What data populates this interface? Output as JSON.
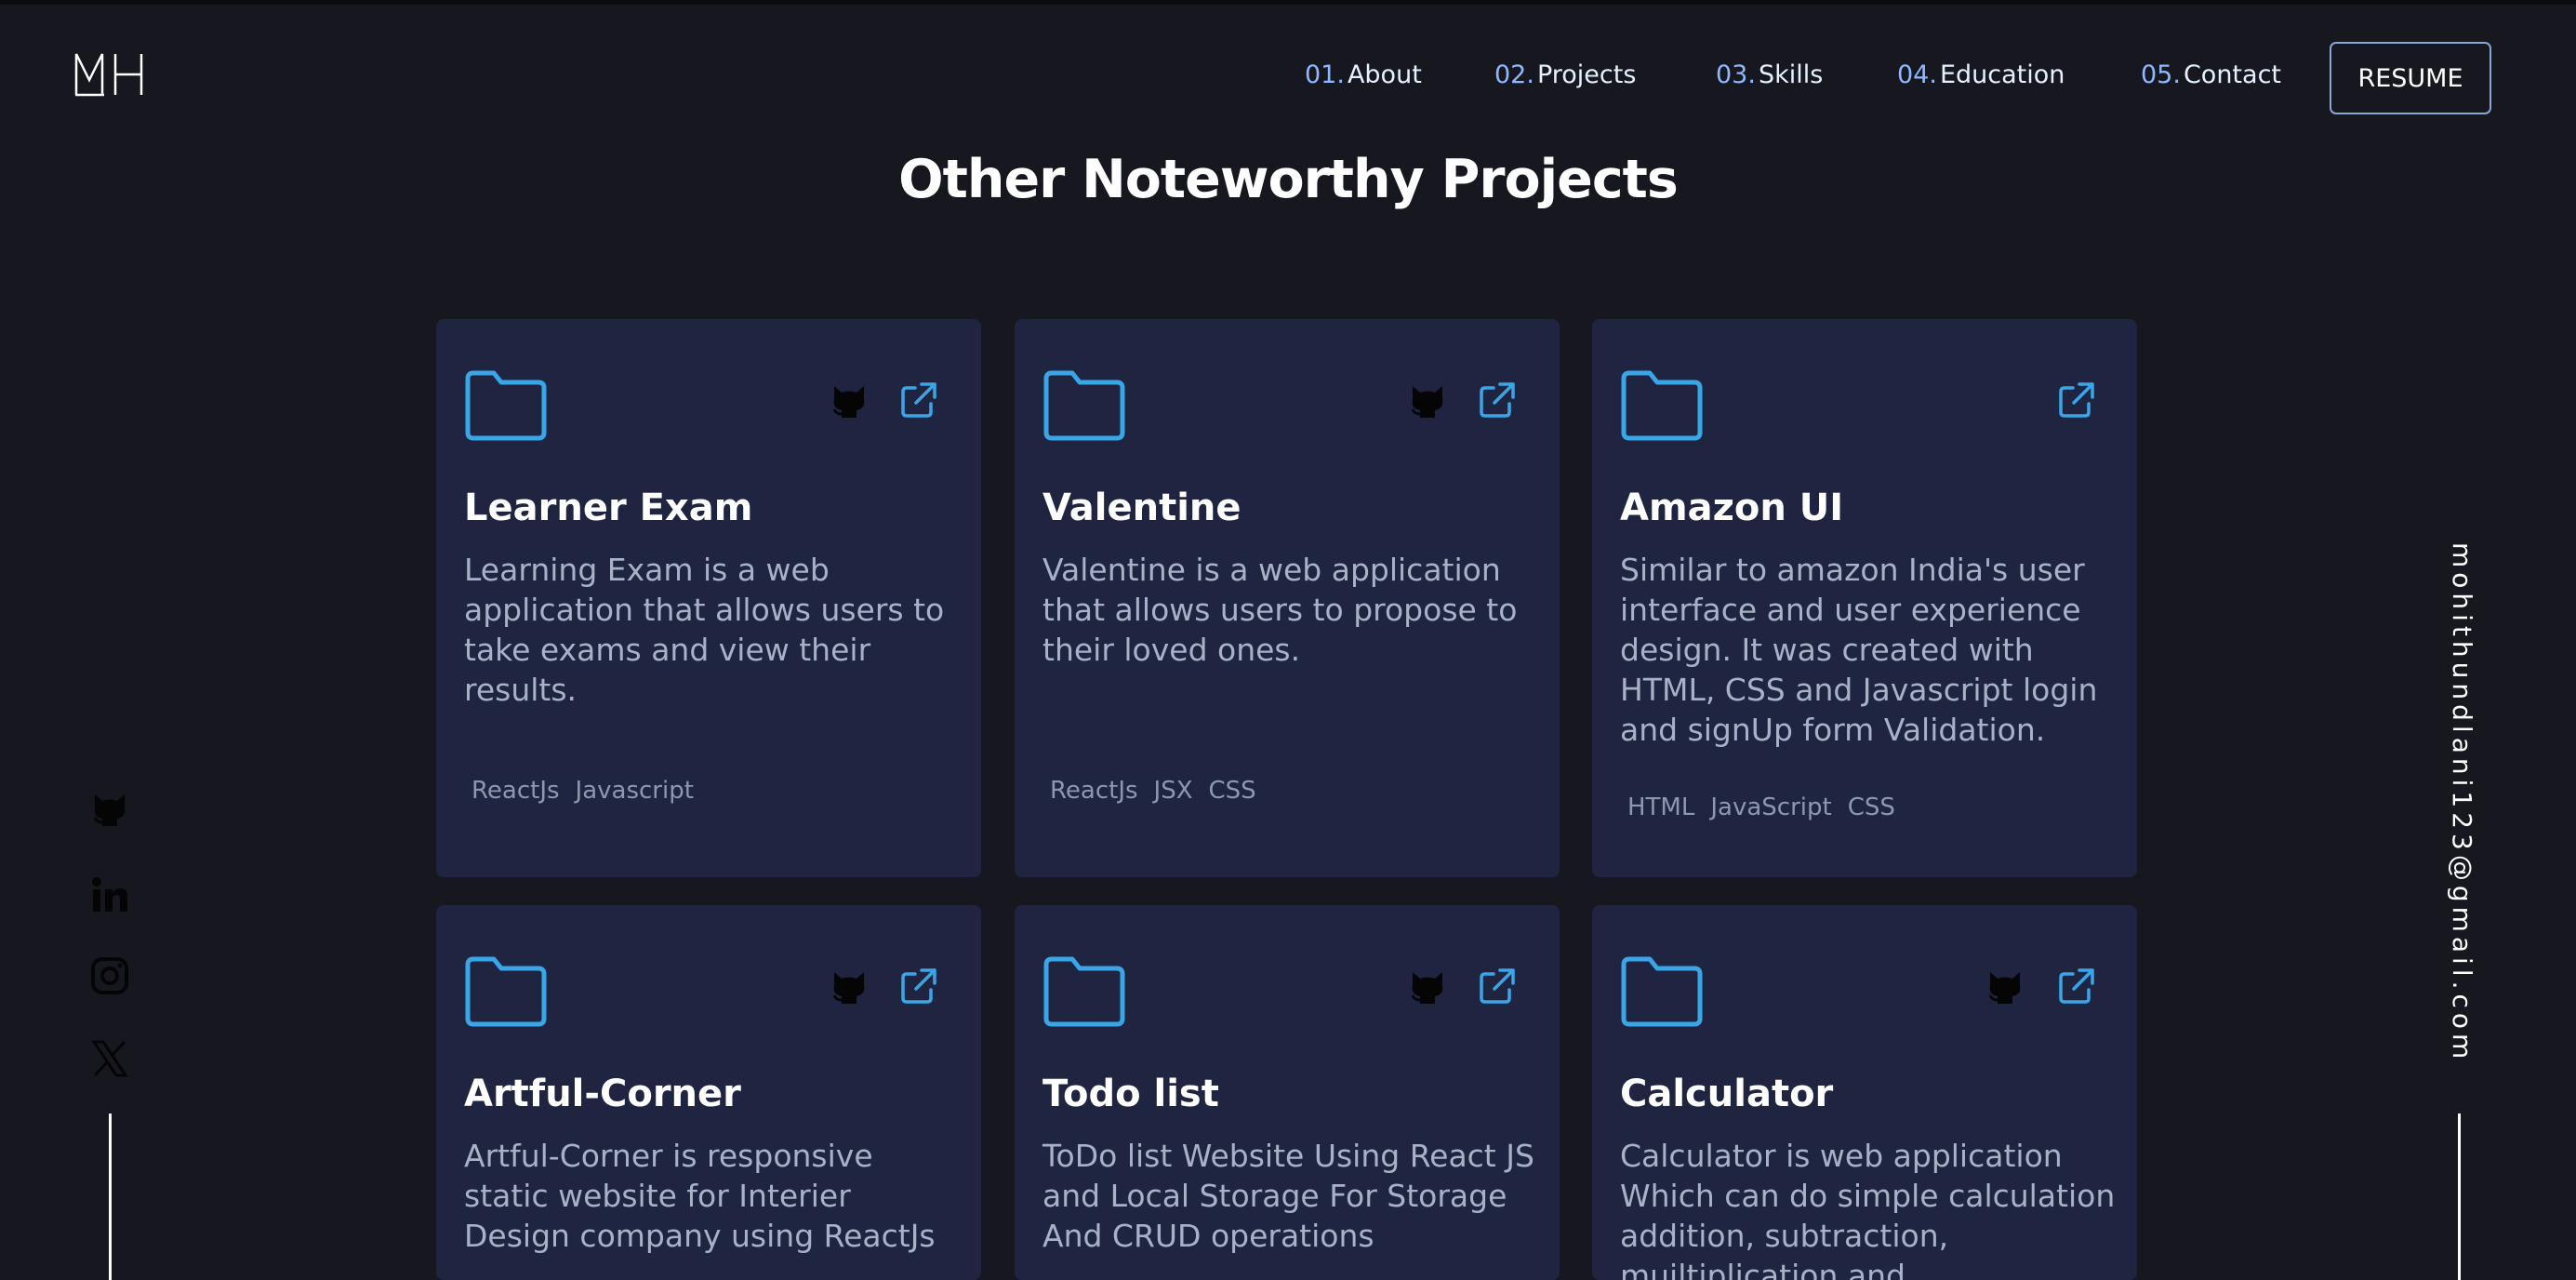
{
  "header": {
    "logo": "MH",
    "nav": [
      {
        "num": "01.",
        "label": "About"
      },
      {
        "num": "02.",
        "label": "Projects"
      },
      {
        "num": "03.",
        "label": "Skills"
      },
      {
        "num": "04.",
        "label": "Education"
      },
      {
        "num": "05.",
        "label": "Contact"
      }
    ],
    "resume_label": "RESUME"
  },
  "section_title": "Other Noteworthy Projects",
  "projects": [
    {
      "title": "Learner Exam",
      "description": "Learning Exam is a web application that allows users to take exams and view their results.",
      "tags": [
        "ReactJs",
        "Javascript"
      ],
      "has_github": true
    },
    {
      "title": "Valentine",
      "description": "Valentine is a web application that allows users to propose to their loved ones.",
      "tags": [
        "ReactJs",
        "JSX",
        "CSS"
      ],
      "has_github": true
    },
    {
      "title": "Amazon UI",
      "description": "Similar to amazon India's user interface and user experience design. It was created with HTML, CSS and Javascript login and signUp form Validation.",
      "tags": [
        "HTML",
        "JavaScript",
        "CSS"
      ],
      "has_github": false
    },
    {
      "title": "Artful-Corner",
      "description": "Artful-Corner is responsive static website for Interier Design company using ReactJs",
      "tags": [],
      "has_github": true
    },
    {
      "title": "Todo list",
      "description": "ToDo list Website Using React JS and Local Storage For Storage And CRUD operations",
      "tags": [],
      "has_github": true
    },
    {
      "title": "Calculator",
      "description": "Calculator is web application Which can do simple calculation addition, subtraction, muiltiplication and",
      "tags": [],
      "has_github": true
    }
  ],
  "social_icons": [
    "github-icon",
    "linkedin-icon",
    "instagram-icon",
    "x-icon"
  ],
  "email": "mohithundlani123@gmail.com",
  "colors": {
    "background": "#17181f",
    "card": "#1f2541",
    "accent": "#3aa6e8",
    "nav_number": "#8eb8ff",
    "muted_text": "#a9b1c6"
  }
}
